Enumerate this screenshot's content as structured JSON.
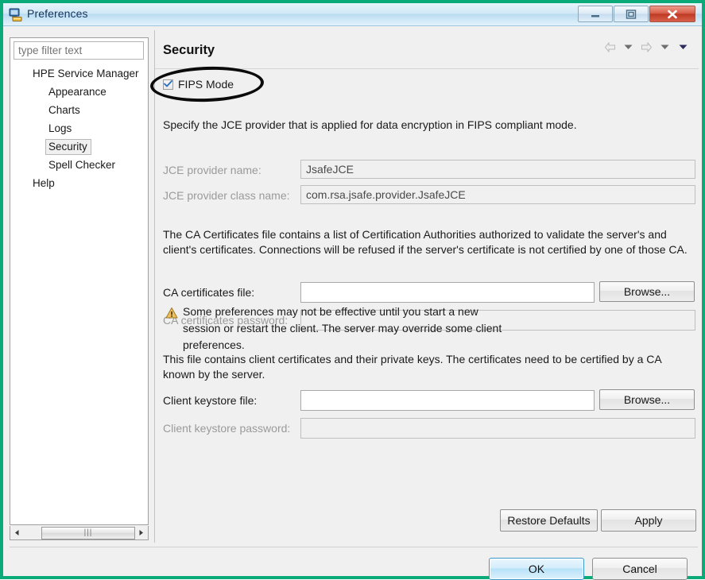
{
  "window": {
    "title": "Preferences",
    "icon": "computer-icon",
    "controls": {
      "minimize": "minimize-icon",
      "maximize": "maximize-icon",
      "close": "close-icon"
    }
  },
  "sidebar": {
    "filter": {
      "placeholder": "type filter text",
      "value": ""
    },
    "items": [
      {
        "label": "HPE Service Manager",
        "level": 1,
        "selected": false
      },
      {
        "label": "Appearance",
        "level": 2,
        "selected": false
      },
      {
        "label": "Charts",
        "level": 2,
        "selected": false
      },
      {
        "label": "Logs",
        "level": 2,
        "selected": false
      },
      {
        "label": "Security",
        "level": 2,
        "selected": true
      },
      {
        "label": "Spell Checker",
        "level": 2,
        "selected": false
      },
      {
        "label": "Help",
        "level": 1,
        "selected": false
      }
    ],
    "scrollbar": {
      "left_arrow": "triangle-left-icon",
      "right_arrow": "triangle-right-icon",
      "grip": "|||"
    }
  },
  "content": {
    "title": "Security",
    "nav": {
      "back": "arrow-left-icon",
      "back_menu": "chevron-down-icon",
      "forward": "arrow-right-icon",
      "forward_menu": "chevron-down-icon",
      "view_menu": "chevron-down-icon"
    },
    "fips": {
      "label": "FIPS Mode",
      "checked": true,
      "check_glyph": "check-icon"
    },
    "jce": {
      "description": "Specify the JCE provider that is applied for data encryption in FIPS compliant mode.",
      "provider_name_label": "JCE provider name:",
      "provider_name_value": "JsafeJCE",
      "provider_class_label": "JCE provider class name:",
      "provider_class_value": "com.rsa.jsafe.provider.JsafeJCE"
    },
    "ca": {
      "description": "The CA Certificates file contains a list of Certification Authorities authorized to validate the server's and client's certificates. Connections will be refused if the server's certificate is not certified by one of those CA.",
      "file_label": "CA certificates file:",
      "file_value": "",
      "browse_label": "Browse...",
      "password_label": "CA certificates password:",
      "password_value": ""
    },
    "keystore": {
      "description": "This file contains client certificates and their private keys. The certificates need to be certified by a CA known by the server.",
      "file_label": "Client keystore file:",
      "file_value": "",
      "browse_label": "Browse...",
      "password_label": "Client keystore password:",
      "password_value": ""
    },
    "warning": {
      "icon": "warning-triangle-icon",
      "text": "Some preferences may not be effective until you start a new session or restart the client. The server may override some client preferences."
    },
    "restore_defaults_label": "Restore Defaults",
    "apply_label": "Apply"
  },
  "footer": {
    "ok_label": "OK",
    "cancel_label": "Cancel"
  },
  "annotation": {
    "highlight_shape": "ellipse",
    "highlight_color": "#0b0b0b",
    "frame_color": "#0aab78"
  }
}
